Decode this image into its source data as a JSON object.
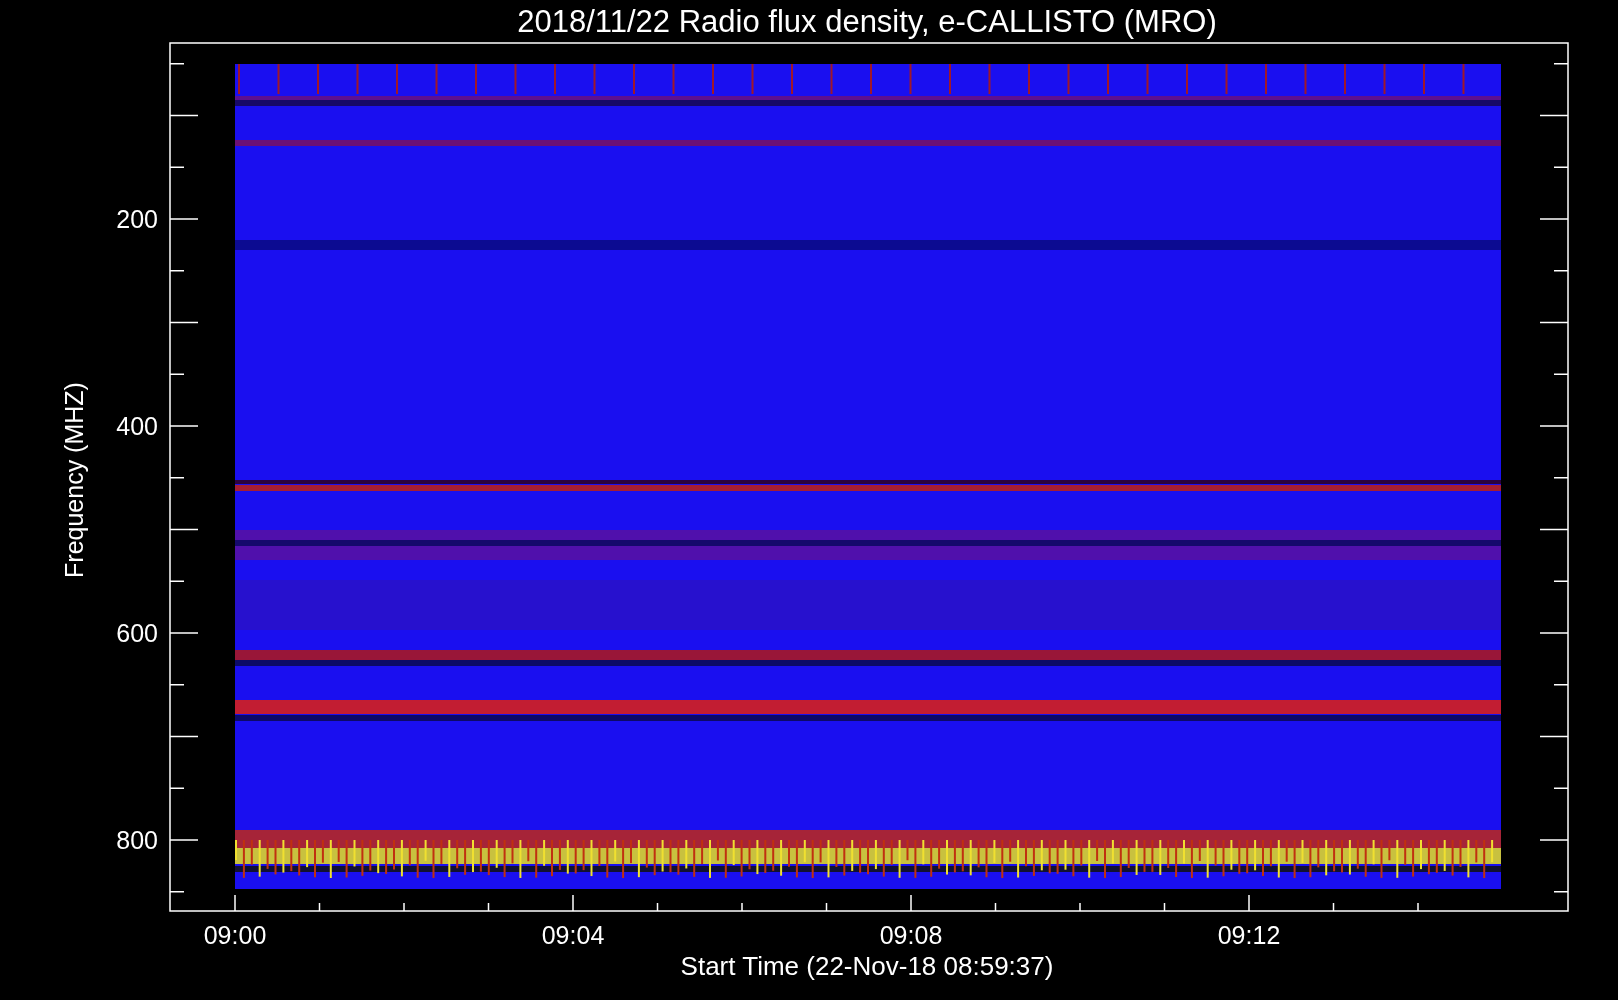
{
  "title": "2018/11/22  Radio flux density, e-CALLISTO (MRO)",
  "y_axis": {
    "label": "Frequency (MHZ)",
    "ticks": [
      "200",
      "400",
      "600",
      "800"
    ]
  },
  "x_axis": {
    "label": "Start Time (22-Nov-18 08:59:37)",
    "ticks": [
      "09:00",
      "09:04",
      "09:08",
      "09:12"
    ]
  }
}
